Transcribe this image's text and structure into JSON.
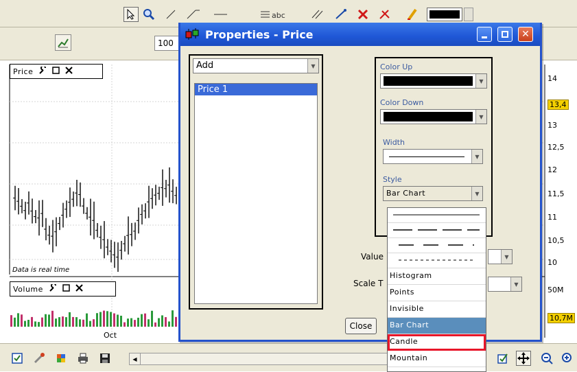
{
  "chart": {
    "price_title": "Price",
    "volume_title": "Volume",
    "realtime_note": "Data is real time",
    "zoom_value": "100",
    "axis_labels": [
      "14",
      "13,4",
      "13",
      "12,5",
      "12",
      "11,5",
      "11",
      "10,5",
      "10",
      "50M",
      "10,7M"
    ],
    "date_label": "Oct",
    "accent_highlight": "#f4d000"
  },
  "dialog": {
    "title": "Properties - Price",
    "add_label": "Add",
    "series": [
      "Price 1"
    ],
    "color_up_label": "Color Up",
    "color_down_label": "Color Down",
    "width_label": "Width",
    "style_label": "Style",
    "style_value": "Bar Chart",
    "value_label": "Value",
    "scale_label": "Scale T",
    "close_label": "Close",
    "style_options": [
      "Histogram",
      "Points",
      "Invisible",
      "Bar Chart",
      "Candle",
      "Mountain"
    ],
    "selected_style": "Bar Chart",
    "highlighted_style": "Candle",
    "colors": {
      "titlebar": "#2452cc",
      "selected": "#5a8ebc",
      "highlight_box": "#e8162a"
    }
  }
}
